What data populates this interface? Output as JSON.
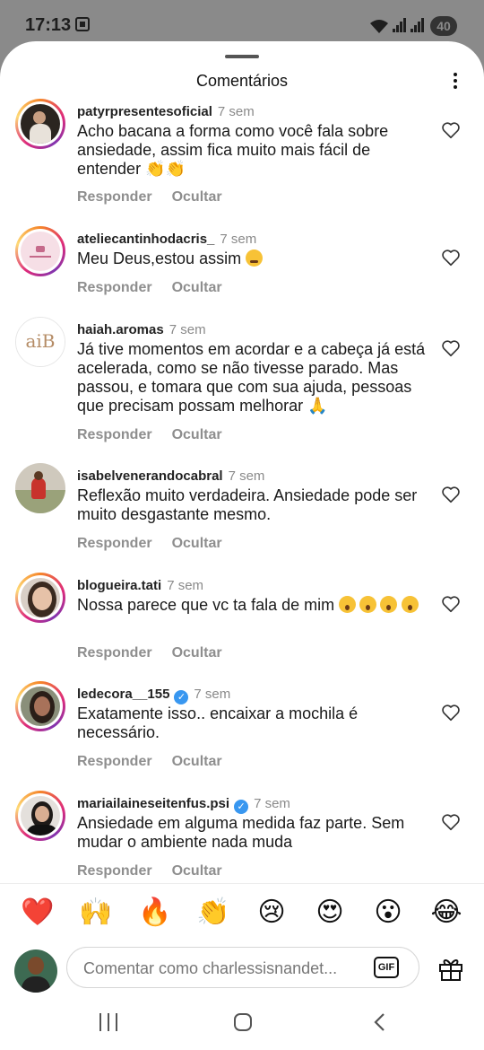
{
  "status_bar": {
    "time": "17:13",
    "battery": "40"
  },
  "header": {
    "title": "Comentários"
  },
  "comments": [
    {
      "username": "patyrpresentesoficial",
      "time": "7 sem",
      "text": "Acho bacana a forma como você fala sobre ansiedade, assim fica muito mais fácil de entender 👏👏",
      "verified": false
    },
    {
      "username": "ateliecantinhodacris_",
      "time": "7 sem",
      "text": "Meu Deus,estou assim",
      "verified": false
    },
    {
      "username": "haiah.aromas",
      "time": "7 sem",
      "text": "Já tive momentos em acordar e a cabeça já está acelerada, como se não tivesse parado. Mas passou, e tomara que com sua ajuda, pessoas que precisam possam melhorar 🙏",
      "verified": false,
      "avatar_text": "aiB"
    },
    {
      "username": "isabelvenerandocabral",
      "time": "7 sem",
      "text": "Reflexão muito verdadeira. Ansiedade pode ser muito desgastante mesmo.",
      "verified": false
    },
    {
      "username": "blogueira.tati",
      "time": "7 sem",
      "text": "Nossa parece que vc ta fala de mim",
      "verified": false
    },
    {
      "username": "ledecora__155",
      "time": "7 sem",
      "text": "Exatamente isso.. encaixar a mochila é necessário.",
      "verified": true
    },
    {
      "username": "mariailaineseitenfus.psi",
      "time": "7 sem",
      "text": "Ansiedade em alguma medida faz parte. Sem mudar o ambiente nada muda",
      "verified": true
    }
  ],
  "actions": {
    "reply": "Responder",
    "hide": "Ocultar"
  },
  "quick_reactions": [
    "❤️",
    "🙌",
    "🔥",
    "👏",
    "😢",
    "😍",
    "😮",
    "😂"
  ],
  "composer": {
    "placeholder": "Comentar como charlessisnandet...",
    "gif_label": "GIF"
  },
  "colors": {
    "verified": "#3897f0",
    "secondary_text": "#8e8e8e",
    "story_ring": [
      "#f58529",
      "#dd2a7b",
      "#8134af"
    ]
  }
}
